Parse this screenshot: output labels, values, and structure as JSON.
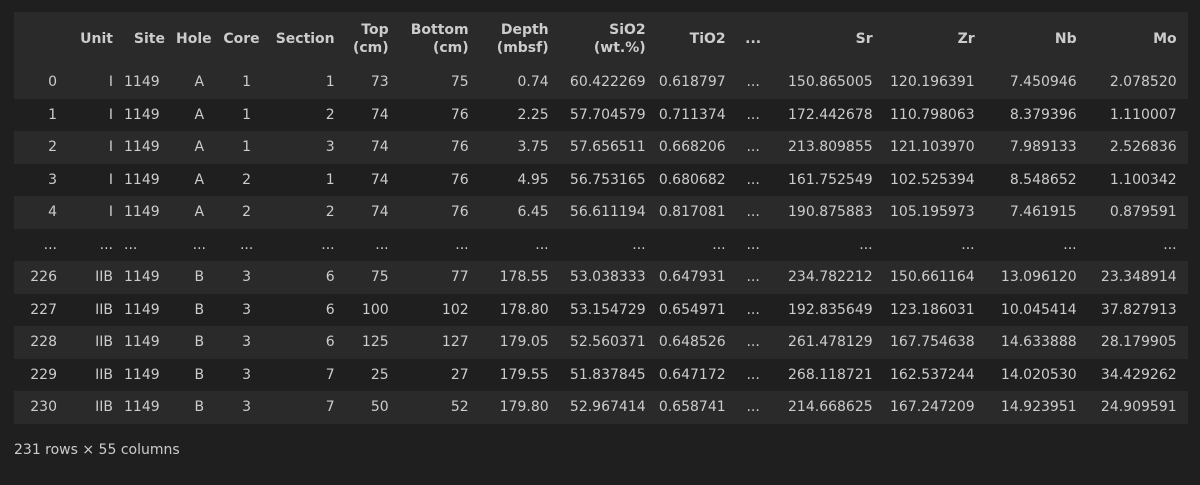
{
  "table": {
    "columns": [
      "",
      "Unit",
      "Site",
      "Hole",
      "Core",
      "Section",
      "Top\n(cm)",
      "Bottom\n(cm)",
      "Depth\n(mbsf)",
      "SiO2\n(wt.%)",
      "TiO2",
      "...",
      "Sr",
      "Zr",
      "Nb",
      "Mo"
    ],
    "rows": [
      [
        "0",
        "I",
        "1149",
        "A",
        "1",
        "1",
        "73",
        "75",
        "0.74",
        "60.422269",
        "0.618797",
        "...",
        "150.865005",
        "120.196391",
        "7.450946",
        "2.078520"
      ],
      [
        "1",
        "I",
        "1149",
        "A",
        "1",
        "2",
        "74",
        "76",
        "2.25",
        "57.704579",
        "0.711374",
        "...",
        "172.442678",
        "110.798063",
        "8.379396",
        "1.110007"
      ],
      [
        "2",
        "I",
        "1149",
        "A",
        "1",
        "3",
        "74",
        "76",
        "3.75",
        "57.656511",
        "0.668206",
        "...",
        "213.809855",
        "121.103970",
        "7.989133",
        "2.526836"
      ],
      [
        "3",
        "I",
        "1149",
        "A",
        "2",
        "1",
        "74",
        "76",
        "4.95",
        "56.753165",
        "0.680682",
        "...",
        "161.752549",
        "102.525394",
        "8.548652",
        "1.100342"
      ],
      [
        "4",
        "I",
        "1149",
        "A",
        "2",
        "2",
        "74",
        "76",
        "6.45",
        "56.611194",
        "0.817081",
        "...",
        "190.875883",
        "105.195973",
        "7.461915",
        "0.879591"
      ],
      [
        "...",
        "...",
        "...",
        "...",
        "...",
        "...",
        "...",
        "...",
        "...",
        "...",
        "...",
        "...",
        "...",
        "...",
        "...",
        "..."
      ],
      [
        "226",
        "IIB",
        "1149",
        "B",
        "3",
        "6",
        "75",
        "77",
        "178.55",
        "53.038333",
        "0.647931",
        "...",
        "234.782212",
        "150.661164",
        "13.096120",
        "23.348914"
      ],
      [
        "227",
        "IIB",
        "1149",
        "B",
        "3",
        "6",
        "100",
        "102",
        "178.80",
        "53.154729",
        "0.654971",
        "...",
        "192.835649",
        "123.186031",
        "10.045414",
        "37.827913"
      ],
      [
        "228",
        "IIB",
        "1149",
        "B",
        "3",
        "6",
        "125",
        "127",
        "179.05",
        "52.560371",
        "0.648526",
        "...",
        "261.478129",
        "167.754638",
        "14.633888",
        "28.179905"
      ],
      [
        "229",
        "IIB",
        "1149",
        "B",
        "3",
        "7",
        "25",
        "27",
        "179.55",
        "51.837845",
        "0.647172",
        "...",
        "268.118721",
        "162.537244",
        "14.020530",
        "34.429262"
      ],
      [
        "230",
        "IIB",
        "1149",
        "B",
        "3",
        "7",
        "50",
        "52",
        "179.80",
        "52.967414",
        "0.658741",
        "...",
        "214.668625",
        "167.247209",
        "14.923951",
        "24.909591"
      ]
    ]
  },
  "footer": {
    "summary": "231 rows × 55 columns"
  }
}
